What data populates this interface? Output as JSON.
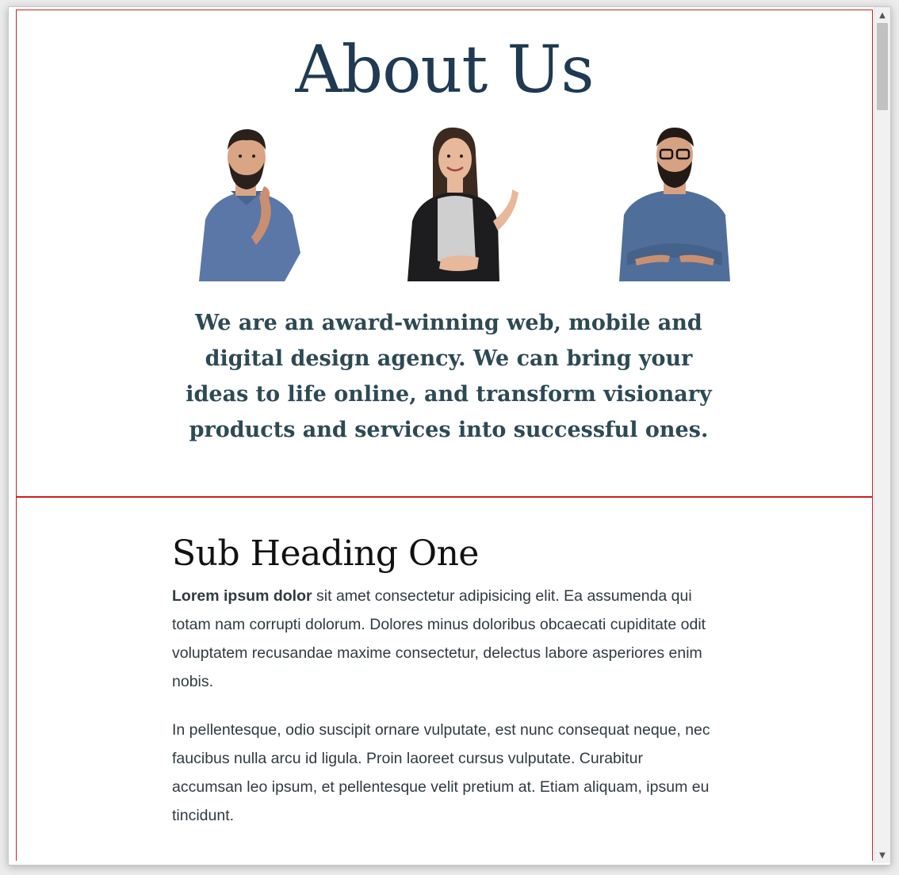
{
  "hero": {
    "title": "About Us",
    "lead": "We are an award-winning web, mobile and digital design agency. We can bring your ideas to life online, and transform visionary products and services into successful ones."
  },
  "team": [
    {
      "name": "team-member-1",
      "shirt": "#5a77a8",
      "skin": "#d9a585",
      "hair": "#2b211c"
    },
    {
      "name": "team-member-2",
      "shirt": "#1d1d1f",
      "skin": "#e7b89a",
      "hair": "#3b2a20"
    },
    {
      "name": "team-member-3",
      "shirt": "#4f6f9a",
      "skin": "#d7a282",
      "hair": "#231a16"
    }
  ],
  "content": {
    "heading": "Sub Heading One",
    "p1_strong": "Lorem ipsum dolor",
    "p1_rest": " sit amet consectetur adipisicing elit. Ea assumenda qui totam nam corrupti dolorum. Dolores minus doloribus obcaecati cupiditate odit voluptatem recusandae maxime consectetur, delectus labore asperiores enim nobis.",
    "p2": "In pellentesque, odio suscipit ornare vulputate, est nunc consequat neque, nec faucibus nulla arcu id ligula. Proin laoreet cursus vulputate. Curabitur accumsan leo ipsum, et pellentesque velit pretium at. Etiam aliquam, ipsum eu tincidunt."
  },
  "scrollbar": {
    "up_icon": "▲",
    "down_icon": "▼"
  },
  "colors": {
    "accent_border": "#cc1f1f",
    "title": "#1f3a52",
    "lead": "#2d4a54"
  }
}
